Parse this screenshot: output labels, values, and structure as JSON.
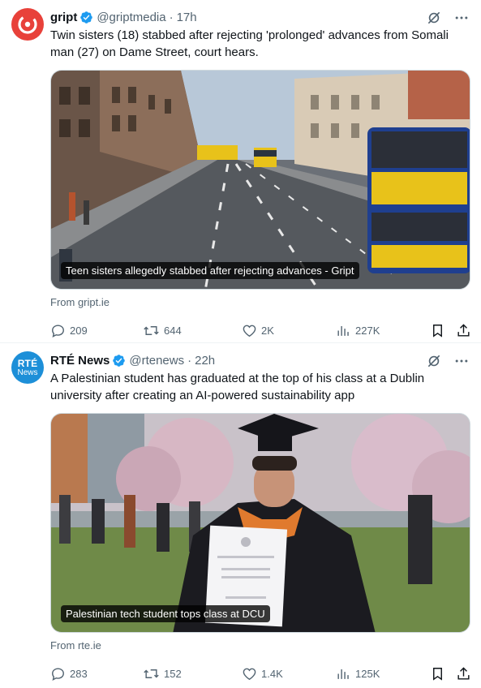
{
  "tweets": [
    {
      "name": "gript",
      "handle": "@griptmedia",
      "separator": "·",
      "time": "17h",
      "text": "Twin sisters (18) stabbed after rejecting 'prolonged' advances from Somali man (27) on Dame Street, court hears.",
      "card_caption": "Teen sisters allegedly stabbed after rejecting advances - Gript",
      "from": "From gript.ie",
      "replies": "209",
      "reposts": "644",
      "likes": "2K",
      "views": "227K"
    },
    {
      "name": "RTÉ News",
      "handle": "@rtenews",
      "separator": "·",
      "time": "22h",
      "text": "A Palestinian student has graduated at the top of his class at a Dublin university after creating an AI-powered sustainability app",
      "card_caption": "Palestinian tech student tops class at DCU",
      "from": "From rte.ie",
      "replies": "283",
      "reposts": "152",
      "likes": "1.4K",
      "views": "125K"
    }
  ],
  "avatars": {
    "rte_line1": "RTÉ",
    "rte_line2": "News"
  },
  "colors": {
    "verified": "#1d9bf0",
    "gript_brand": "#e8413a",
    "rte_brand": "#1d8fd8",
    "secondary_text": "#536471"
  },
  "icons": [
    "verified-badge-icon",
    "grok-icon",
    "more-icon",
    "reply-icon",
    "repost-icon",
    "like-icon",
    "views-icon",
    "bookmark-icon",
    "share-icon"
  ]
}
